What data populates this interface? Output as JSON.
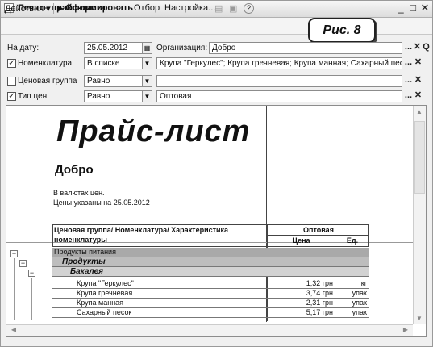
{
  "window": {
    "title": "Печать прайс-листа",
    "min": "_",
    "max": "□",
    "close": "✕"
  },
  "toolbar": {
    "actions": "Действия",
    "generate": "Сформировать",
    "filter": "Отбор",
    "settings": "Настройка..."
  },
  "badge": "Рис. 8",
  "form": {
    "date_label": "На дату:",
    "date_value": "25.05.2012",
    "org_label": "Организация:",
    "org_value": "Добро",
    "nom_label": "Номенклатура",
    "nom_mode": "В списке",
    "nom_value": "Крупа \"Геркулес\"; Крупа гречневая; Крупа манная; Сахарный песок",
    "pricegroup_label": "Ценовая группа",
    "pricegroup_mode": "Равно",
    "pricegroup_value": "",
    "pricetype_label": "Тип цен",
    "pricetype_mode": "Равно",
    "pricetype_value": "Оптовая",
    "ellipsis": "...",
    "clear": "✕",
    "search": "Q"
  },
  "report": {
    "title": "Прайс-лист",
    "org": "Добро",
    "currency_note": "В валютах цен.",
    "date_note": "Цены указаны на 25.05.2012",
    "header": {
      "group": "Ценовая группа/ Номенклатура/ Характеристика",
      "nomenclature": "номенклатуры",
      "price_type": "Оптовая",
      "price": "Цена",
      "unit": "Ед."
    },
    "rows": [
      {
        "name": "Продукты питания",
        "price": "",
        "unit": ""
      },
      {
        "name": "Продукты",
        "price": "",
        "unit": ""
      },
      {
        "name": "Бакалея",
        "price": "",
        "unit": ""
      },
      {
        "name": "Крупа \"Геркулес\"",
        "price": "1,32 грн",
        "unit": "кг"
      },
      {
        "name": "Крупа гречневая",
        "price": "3,74 грн",
        "unit": "упак"
      },
      {
        "name": "Крупа манная",
        "price": "2,31 грн",
        "unit": "упак"
      },
      {
        "name": "Сахарный песок",
        "price": "5,17 грн",
        "unit": "упак"
      }
    ]
  }
}
